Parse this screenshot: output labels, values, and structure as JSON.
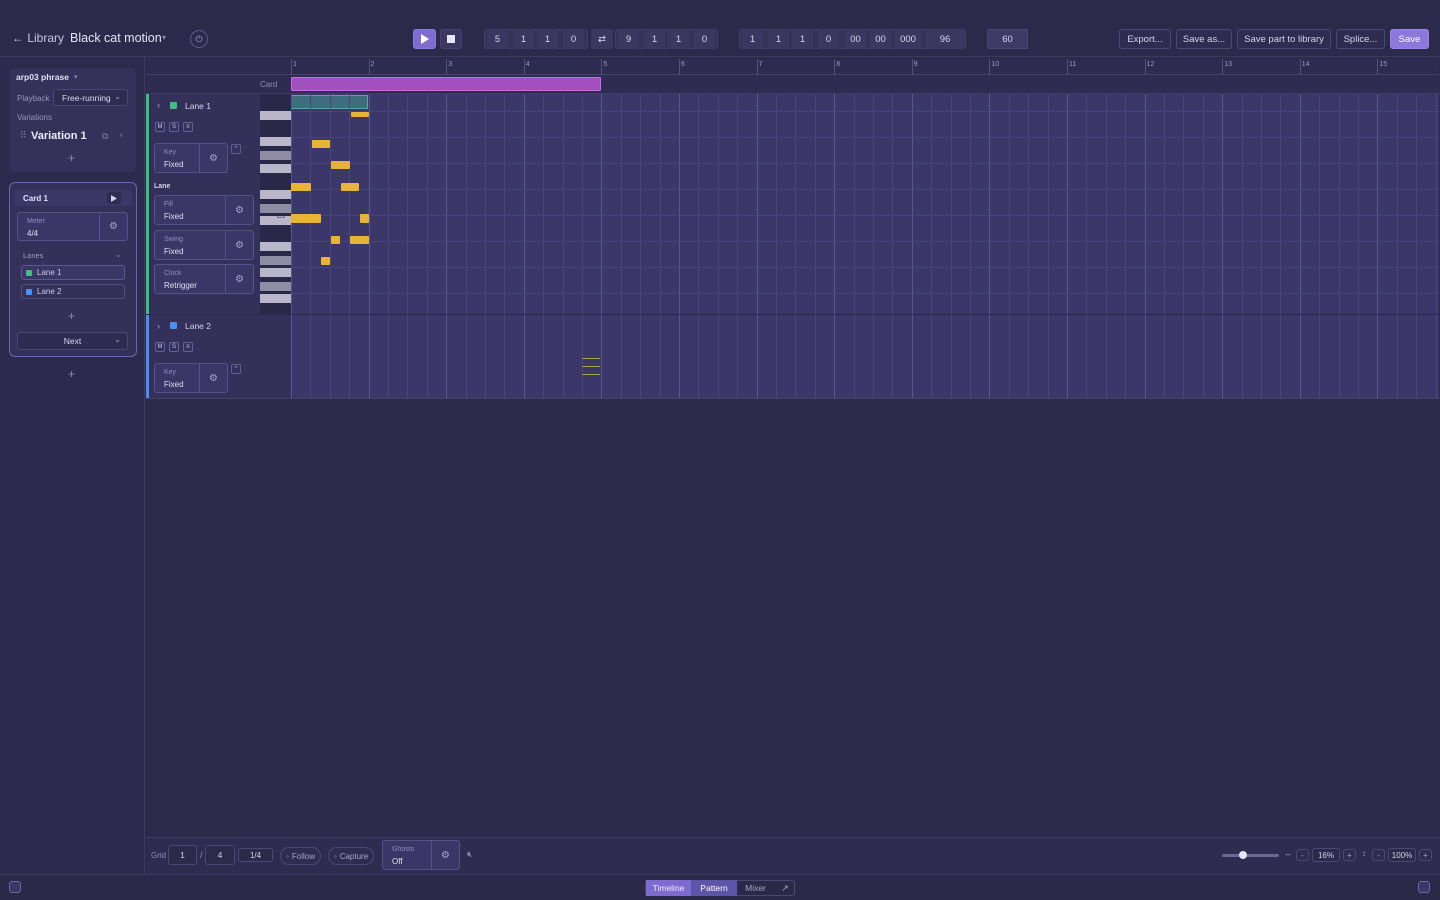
{
  "header": {
    "back_label": "← Library",
    "project_title": "Black cat motion",
    "title_caret": "▾",
    "power_icon": "⏻",
    "transport": {
      "position": [
        "5",
        "1",
        "1",
        "0"
      ],
      "loop_icon": "⇄",
      "loop_end": [
        "9",
        "1",
        "1",
        "0"
      ],
      "time": [
        "1",
        "1",
        "1",
        "0",
        "00",
        "00",
        "000"
      ],
      "ppq": "96",
      "tempo": "60"
    },
    "actions": {
      "export": "Export...",
      "save_as": "Save as...",
      "save_part": "Save part to library",
      "splice": "Splice...",
      "save": "Save"
    }
  },
  "sidebar": {
    "phrase_name": "arp03 phrase",
    "playback_label": "Playback",
    "playback_value": "Free-running",
    "variations_label": "Variations",
    "variation_name": "Variation 1",
    "add": "+",
    "card": {
      "title": "Card 1",
      "meter_label": "Meter",
      "meter_value": "4/4",
      "lanes_label": "Lanes",
      "lanes": [
        {
          "name": "Lane 1",
          "color": "#3fbf7f"
        },
        {
          "name": "Lane 2",
          "color": "#4c8ff0"
        }
      ],
      "next_label": "Next"
    }
  },
  "timeline": {
    "card_label": "Card",
    "bars": [
      "1",
      "2",
      "3",
      "4",
      "5",
      "6",
      "7",
      "8",
      "9",
      "10",
      "11",
      "12",
      "13",
      "14",
      "15"
    ],
    "note_label": "C3",
    "lane_section_label": "Lane"
  },
  "lanes": [
    {
      "name": "Lane 1",
      "color": "#3fbf7f",
      "mute": "M",
      "solo": "S",
      "params": [
        {
          "label": "Key",
          "value": "Fixed"
        },
        {
          "label": "Fill",
          "value": "Fixed"
        },
        {
          "label": "Swing",
          "value": "Fixed"
        },
        {
          "label": "Clock",
          "value": "Retrigger"
        }
      ]
    },
    {
      "name": "Lane 2",
      "color": "#4c8ff0",
      "mute": "M",
      "solo": "S",
      "params": [
        {
          "label": "Key",
          "value": "Fixed"
        }
      ]
    }
  ],
  "bottom": {
    "grid_label": "Grid",
    "grid_a": "1",
    "grid_sep": "/",
    "grid_b": "4",
    "grid_div": "1/4",
    "follow": "Follow",
    "capture": "Capture",
    "ghosts_label": "Ghosts",
    "ghosts_value": "Off",
    "zoom_h": "16%",
    "zoom_v": "100%"
  },
  "tabs": {
    "timeline": "Timeline",
    "pattern": "Pattern",
    "mixer": "Mixer"
  }
}
